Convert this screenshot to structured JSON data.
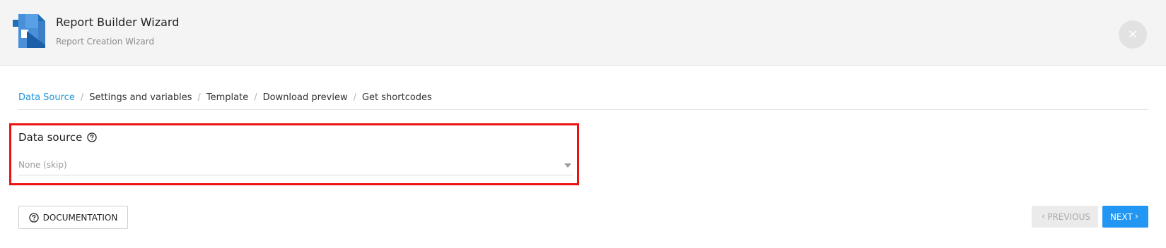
{
  "header": {
    "title": "Report Builder Wizard",
    "subtitle": "Report Creation Wizard",
    "close_label": "×",
    "logo_icon": "report-builder-logo-icon"
  },
  "steps": [
    {
      "label": "Data Source",
      "active": true
    },
    {
      "label": "Settings and variables",
      "active": false
    },
    {
      "label": "Template",
      "active": false
    },
    {
      "label": "Download preview",
      "active": false
    },
    {
      "label": "Get shortcodes",
      "active": false
    }
  ],
  "step_separator": "/",
  "data_source": {
    "label": "Data source",
    "help_icon": "question-circle-icon",
    "selected_value": "None (skip)"
  },
  "footer": {
    "documentation_label": "DOCUMENTATION",
    "previous_label": "PREVIOUS",
    "next_label": "NEXT",
    "previous_chevron": "‹",
    "next_chevron": "›"
  },
  "colors": {
    "accent": "#2196f3",
    "active_step": "#2196d9",
    "highlight_border": "#ee1111",
    "header_bg": "#f4f4f4"
  }
}
